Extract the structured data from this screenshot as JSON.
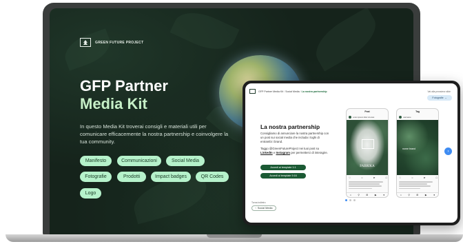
{
  "brand": {
    "name": "GREEN FUTURE PROJECT"
  },
  "hero": {
    "title_line1": "GFP Partner",
    "title_line2": "Media Kit",
    "description": "In questo Media Kit troverai consigli e materiali utili per comunicare efficacemente la nostra partnership e coinvolgere la tua community."
  },
  "pills": [
    {
      "label": "Manifesto"
    },
    {
      "label": "Communicazioni"
    },
    {
      "label": "Social Media"
    },
    {
      "label": "Fotografie"
    },
    {
      "label": "Prodotti"
    },
    {
      "label": "Impact badges"
    },
    {
      "label": "QR Codes"
    },
    {
      "label": "Logo"
    }
  ],
  "tablet": {
    "breadcrumb": {
      "root": "GFP Partner Media Kit",
      "sep1": "/",
      "middle": "Social Media",
      "sep2": "/",
      "current": "La nostra partnership"
    },
    "select_label": "Vai alla prossima slide",
    "select_value": "Fotografie",
    "heading": "La nostra partnership",
    "paragraph1": "Consigliamo di annunciare la nostra partnership con un post sui social media che includa i loghi di entrambi i brand.",
    "paragraph2_prefix": "Taggo @GreenFutureProject nei tuoi post su ",
    "paragraph2_link1": "LinkedIn",
    "paragraph2_mid": " e ",
    "paragraph2_link2": "Instagram",
    "paragraph2_suffix": " per permetterci di interagire.",
    "download_buttons": [
      {
        "label": "Accedi ai template 1:1"
      },
      {
        "label": "Accedi ai template 9:16"
      }
    ],
    "back_label": "Torna indietro",
    "back_button": "Social Media",
    "phones": [
      {
        "header": "Post",
        "user": "Lorem ipsum dolor sit amet",
        "image_title": "FABRIKA"
      },
      {
        "header": "Tag",
        "user": "username",
        "image_title": "nome brand"
      }
    ]
  },
  "colors": {
    "screen_bg": "#15231b",
    "pill_bg": "#b6f2cb",
    "title_accent": "#c7f0c8",
    "tablet_button": "#1b5a34",
    "accent_blue": "#3f8cf2"
  }
}
